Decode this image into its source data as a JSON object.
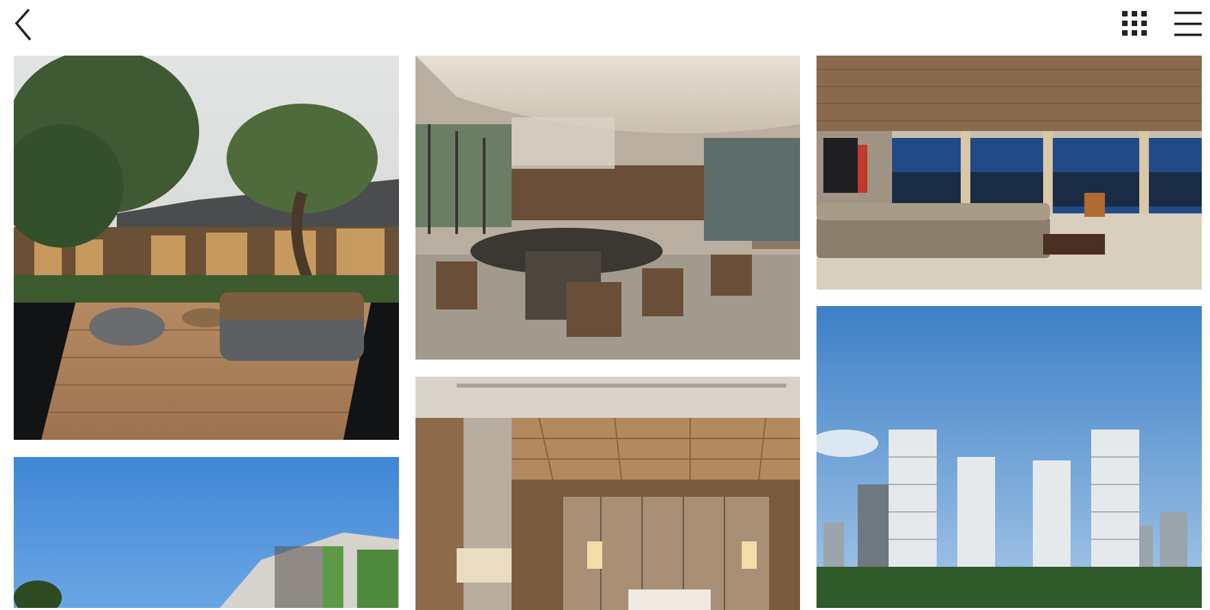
{
  "nav": {
    "back_icon": "chevron-left-icon",
    "grid_icon": "grid-icon",
    "menu_icon": "hamburger-menu-icon"
  },
  "gallery": {
    "images": [
      {
        "subject": "courtyard-deck-with-trees"
      },
      {
        "subject": "dining-lounge-interior"
      },
      {
        "subject": "living-room-with-city-view"
      },
      {
        "subject": "building-facade-blue-sky"
      },
      {
        "subject": "bedroom-timber-ceiling"
      },
      {
        "subject": "residential-towers-skyline"
      }
    ]
  },
  "colors": {
    "icon": "#222222",
    "background": "#ffffff"
  }
}
